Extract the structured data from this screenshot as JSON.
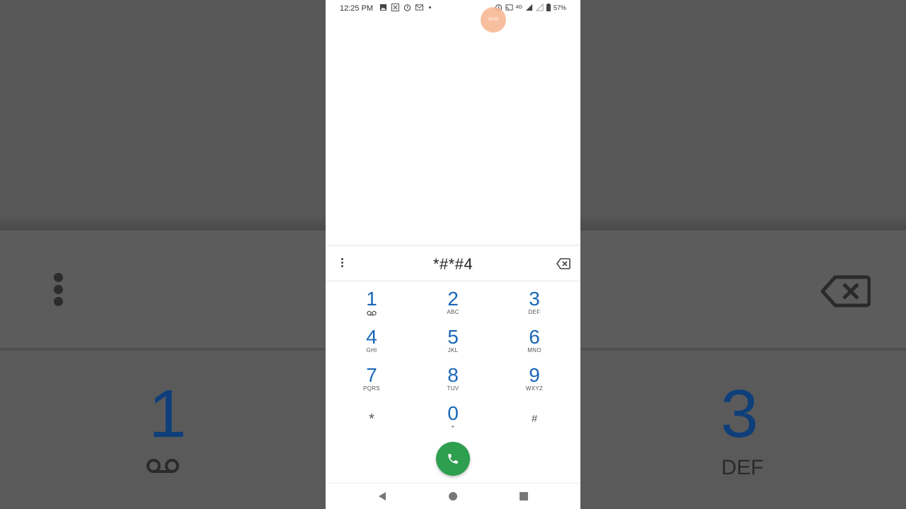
{
  "status_bar": {
    "time": "12:25 PM",
    "battery": "57%",
    "network": "4G"
  },
  "touch_indicator": {
    "label": "00:00"
  },
  "dialer": {
    "number": "*#*#4",
    "keys": [
      {
        "num": "1",
        "sub": ""
      },
      {
        "num": "2",
        "sub": "ABC"
      },
      {
        "num": "3",
        "sub": "DEF"
      },
      {
        "num": "4",
        "sub": "GHI"
      },
      {
        "num": "5",
        "sub": "JKL"
      },
      {
        "num": "6",
        "sub": "MNO"
      },
      {
        "num": "7",
        "sub": "PQRS"
      },
      {
        "num": "8",
        "sub": "TUV"
      },
      {
        "num": "9",
        "sub": "WXYZ"
      },
      {
        "num": "*",
        "sub": ""
      },
      {
        "num": "0",
        "sub": "+"
      },
      {
        "num": "#",
        "sub": ""
      }
    ]
  },
  "background": {
    "digit_left": "1",
    "digit_right": "3",
    "sub_right": "DEF"
  },
  "colors": {
    "digit": "#1a67b8",
    "call_button": "#2e9e4f"
  },
  "icons": [
    "image-icon",
    "app-icon",
    "alarm-icon",
    "mail-icon",
    "cast-icon",
    "signal-icon",
    "battery-icon",
    "voicemail-icon",
    "menu-dots-icon",
    "backspace-icon",
    "phone-icon",
    "back-icon",
    "home-icon",
    "recents-icon"
  ]
}
